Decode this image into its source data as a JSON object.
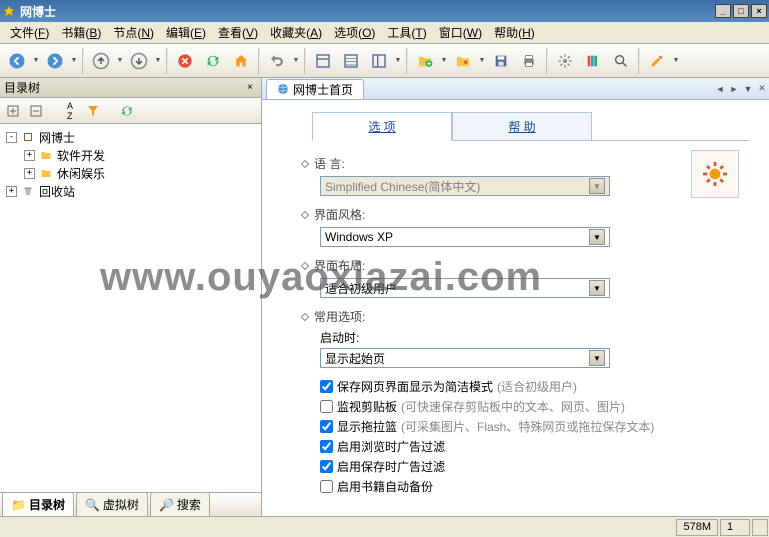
{
  "window": {
    "title": "网博士"
  },
  "menu": {
    "items": [
      {
        "label": "文件",
        "key": "F"
      },
      {
        "label": "书籍",
        "key": "B"
      },
      {
        "label": "节点",
        "key": "N"
      },
      {
        "label": "编辑",
        "key": "E"
      },
      {
        "label": "查看",
        "key": "V"
      },
      {
        "label": "收藏夹",
        "key": "A"
      },
      {
        "label": "选项",
        "key": "O"
      },
      {
        "label": "工具",
        "key": "T"
      },
      {
        "label": "窗口",
        "key": "W"
      },
      {
        "label": "帮助",
        "key": "H"
      }
    ]
  },
  "leftpanel": {
    "title": "目录树",
    "tree": [
      {
        "depth": 1,
        "exp": "-",
        "icon": "book",
        "label": "网博士"
      },
      {
        "depth": 2,
        "exp": "+",
        "icon": "folder",
        "label": "软件开发"
      },
      {
        "depth": 2,
        "exp": "+",
        "icon": "folder",
        "label": "休闲娱乐"
      },
      {
        "depth": 1,
        "exp": "+",
        "icon": "recycle",
        "label": "回收站"
      }
    ],
    "tabs": [
      {
        "icon": "📁",
        "label": "目录树",
        "active": true
      },
      {
        "icon": "🔍",
        "label": "虚拟树",
        "active": false
      },
      {
        "icon": "🔎",
        "label": "搜索",
        "active": false
      }
    ]
  },
  "doctab": {
    "label": "网博士首页"
  },
  "inner": {
    "tabs": [
      {
        "label": "选  项",
        "active": true
      },
      {
        "label": "帮  助",
        "active": false
      }
    ]
  },
  "form": {
    "lang_label": "语  言:",
    "lang_value": "Simplified Chinese(简体中文)",
    "style_label": "界面风格:",
    "style_value": "Windows XP",
    "layout_label": "界面布局:",
    "layout_value": "适合初级用户",
    "common_label": "常用选项:",
    "startup_label": "启动时:",
    "startup_value": "显示起始页",
    "checks": [
      {
        "checked": true,
        "label": "保存网页界面显示为简洁模式",
        "hint": "(适合初级用户)"
      },
      {
        "checked": false,
        "label": "监视剪贴板",
        "hint": "(可快速保存剪贴板中的文本、网页、图片)"
      },
      {
        "checked": true,
        "label": "显示拖拉篮",
        "hint": "(可采集图片、Flash、特殊网页或拖拉保存文本)"
      },
      {
        "checked": true,
        "label": "启用浏览时广告过滤",
        "hint": ""
      },
      {
        "checked": true,
        "label": "启用保存时广告过滤",
        "hint": ""
      },
      {
        "checked": false,
        "label": "启用书籍自动备份",
        "hint": ""
      }
    ]
  },
  "status": {
    "mem": "578M",
    "num": "1"
  },
  "watermark": "www.ouyaoxiazai.com"
}
